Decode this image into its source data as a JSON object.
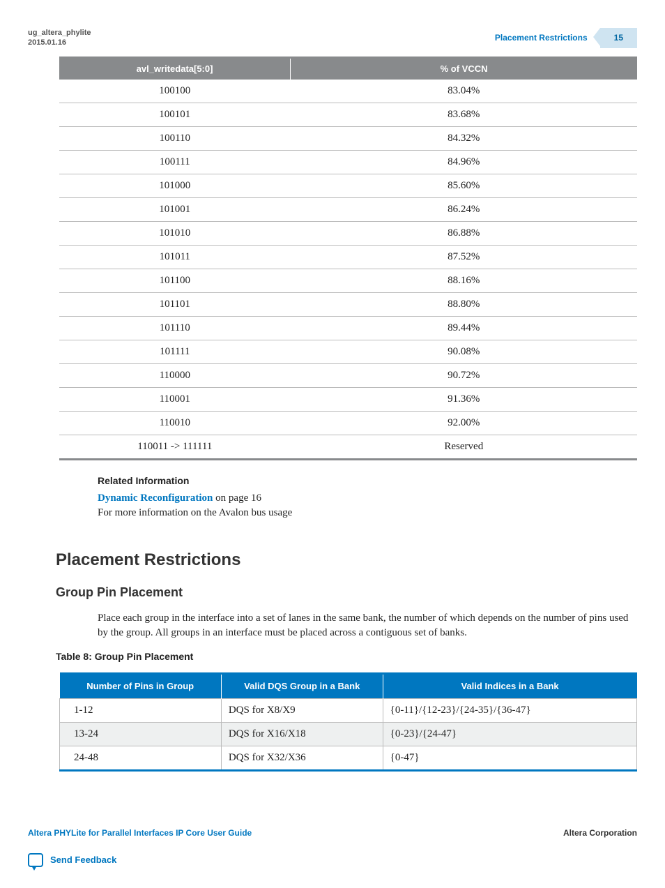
{
  "header": {
    "doc_id": "ug_altera_phylite",
    "date": "2015.01.16",
    "topic": "Placement Restrictions",
    "page_number": "15"
  },
  "table1": {
    "headers": [
      "avl_writedata[5:0]",
      "% of VCCN"
    ],
    "rows": [
      [
        "100100",
        "83.04%"
      ],
      [
        "100101",
        "83.68%"
      ],
      [
        "100110",
        "84.32%"
      ],
      [
        "100111",
        "84.96%"
      ],
      [
        "101000",
        "85.60%"
      ],
      [
        "101001",
        "86.24%"
      ],
      [
        "101010",
        "86.88%"
      ],
      [
        "101011",
        "87.52%"
      ],
      [
        "101100",
        "88.16%"
      ],
      [
        "101101",
        "88.80%"
      ],
      [
        "101110",
        "89.44%"
      ],
      [
        "101111",
        "90.08%"
      ],
      [
        "110000",
        "90.72%"
      ],
      [
        "110001",
        "91.36%"
      ],
      [
        "110010",
        "92.00%"
      ],
      [
        "110011 -> 111111",
        "Reserved"
      ]
    ]
  },
  "related": {
    "heading": "Related Information",
    "link_text": "Dynamic Reconfiguration",
    "link_tail": " on page 16",
    "desc": "For more information on the Avalon bus usage"
  },
  "sections": {
    "h1": "Placement Restrictions",
    "h2": "Group Pin Placement",
    "para": "Place each group in the interface into a set of lanes in the same bank, the number of which depends on the number of pins used by the group. All groups in an interface must be placed across a contiguous set of banks.",
    "table_caption": "Table 8: Group Pin Placement"
  },
  "table2": {
    "headers": [
      "Number of Pins in Group",
      "Valid DQS Group in a Bank",
      "Valid Indices in a Bank"
    ],
    "rows": [
      [
        "1-12",
        "DQS for X8/X9",
        "{0-11}/{12-23}/{24-35}/{36-47}"
      ],
      [
        "13-24",
        "DQS for X16/X18",
        "{0-23}/{24-47}"
      ],
      [
        "24-48",
        "DQS for X32/X36",
        "{0-47}"
      ]
    ]
  },
  "footer": {
    "left": "Altera PHYLite for Parallel Interfaces IP Core User Guide",
    "right": "Altera Corporation",
    "feedback": "Send Feedback"
  }
}
